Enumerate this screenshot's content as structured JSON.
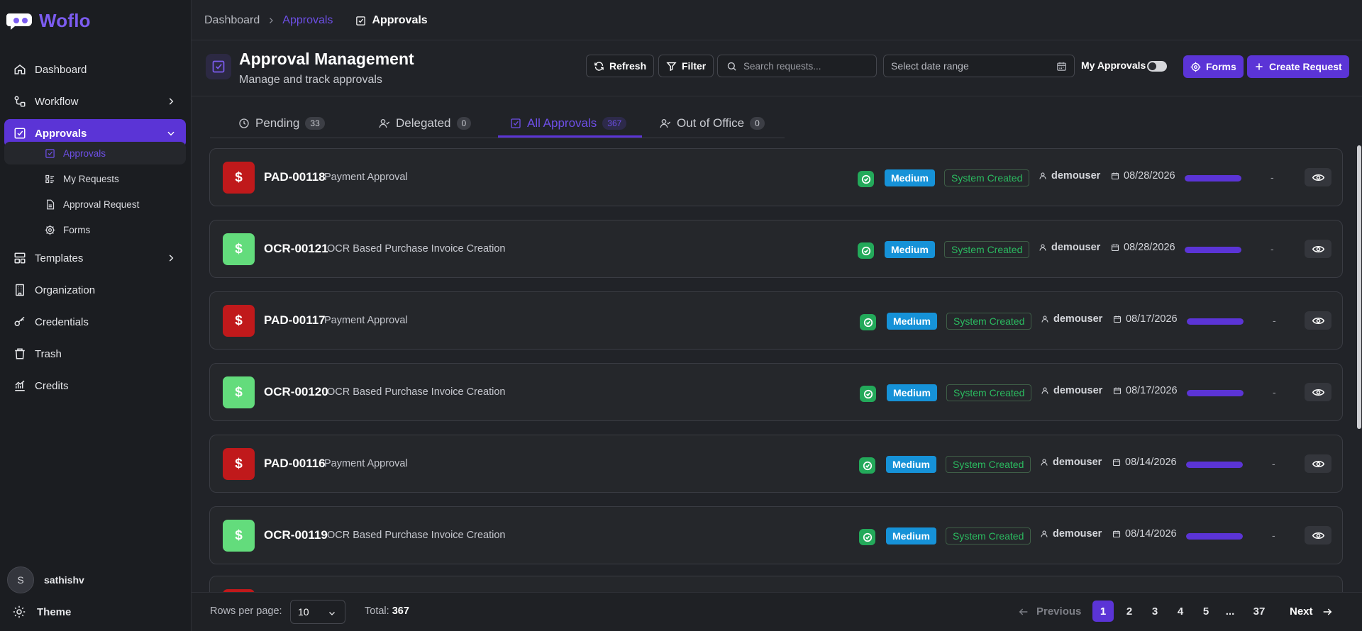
{
  "app": {
    "name": "Woflo"
  },
  "sidebar": {
    "items": [
      {
        "label": "Dashboard",
        "icon": "home-icon"
      },
      {
        "label": "Workflow",
        "icon": "workflow-icon"
      },
      {
        "label": "Approvals",
        "icon": "approvals-icon",
        "active": true
      },
      {
        "label": "Templates",
        "icon": "templates-icon"
      },
      {
        "label": "Organization",
        "icon": "building-icon"
      },
      {
        "label": "Credentials",
        "icon": "key-icon"
      },
      {
        "label": "Trash",
        "icon": "trash-icon"
      },
      {
        "label": "Credits",
        "icon": "chart-icon"
      }
    ],
    "subitems": [
      {
        "label": "Approvals",
        "icon": "approvals-icon",
        "active": true
      },
      {
        "label": "My Requests",
        "icon": "list-icon"
      },
      {
        "label": "Approval Request",
        "icon": "document-icon"
      },
      {
        "label": "Forms",
        "icon": "gear-icon"
      }
    ],
    "user": {
      "initial": "S",
      "name": "sathishv"
    },
    "theme_label": "Theme"
  },
  "breadcrumb": {
    "root": "Dashboard",
    "section": "Approvals",
    "current": "Approvals"
  },
  "header": {
    "title": "Approval Management",
    "subtitle": "Manage and track approvals",
    "refresh_label": "Refresh",
    "filter_label": "Filter",
    "search_placeholder": "Search requests...",
    "date_placeholder": "Select date range",
    "my_approvals_label": "My Approvals",
    "forms_label": "Forms",
    "create_label": "Create Request"
  },
  "tabs": [
    {
      "label": "Pending",
      "count": "33"
    },
    {
      "label": "Delegated",
      "count": "0"
    },
    {
      "label": "All Approvals",
      "count": "367",
      "active": true
    },
    {
      "label": "Out of Office",
      "count": "0"
    }
  ],
  "colors": {
    "accent": "#5b34d6",
    "payment": "#c0191b",
    "ocr": "#63dc7c",
    "priority": "#1692d8",
    "success": "#23a95a"
  },
  "requests": [
    {
      "id": "PAD-00118",
      "name": "Payment Approval",
      "type": "payment",
      "priority": "Medium",
      "source": "System Created",
      "user": "demouser",
      "date": "08/28/2026",
      "progress": 1.0,
      "assignee": "-"
    },
    {
      "id": "OCR-00121",
      "name": "OCR Based Purchase Invoice Creation",
      "type": "ocr",
      "priority": "Medium",
      "source": "System Created",
      "user": "demouser",
      "date": "08/28/2026",
      "progress": 1.0,
      "assignee": "-"
    },
    {
      "id": "PAD-00117",
      "name": "Payment Approval",
      "type": "payment",
      "priority": "Medium",
      "source": "System Created",
      "user": "demouser",
      "date": "08/17/2026",
      "progress": 1.0,
      "assignee": "-"
    },
    {
      "id": "OCR-00120",
      "name": "OCR Based Purchase Invoice Creation",
      "type": "ocr",
      "priority": "Medium",
      "source": "System Created",
      "user": "demouser",
      "date": "08/17/2026",
      "progress": 1.0,
      "assignee": "-"
    },
    {
      "id": "PAD-00116",
      "name": "Payment Approval",
      "type": "payment",
      "priority": "Medium",
      "source": "System Created",
      "user": "demouser",
      "date": "08/14/2026",
      "progress": 1.0,
      "assignee": "-"
    },
    {
      "id": "OCR-00119",
      "name": "OCR Based Purchase Invoice Creation",
      "type": "ocr",
      "priority": "Medium",
      "source": "System Created",
      "user": "demouser",
      "date": "08/14/2026",
      "progress": 1.0,
      "assignee": "-"
    }
  ],
  "pagination": {
    "rows_label": "Rows per page:",
    "rows_value": "10",
    "total_label": "Total:",
    "total_value": "367",
    "prev_label": "Previous",
    "next_label": "Next",
    "pages": [
      "1",
      "2",
      "3",
      "4",
      "5",
      "...",
      "37"
    ],
    "current": "1"
  }
}
